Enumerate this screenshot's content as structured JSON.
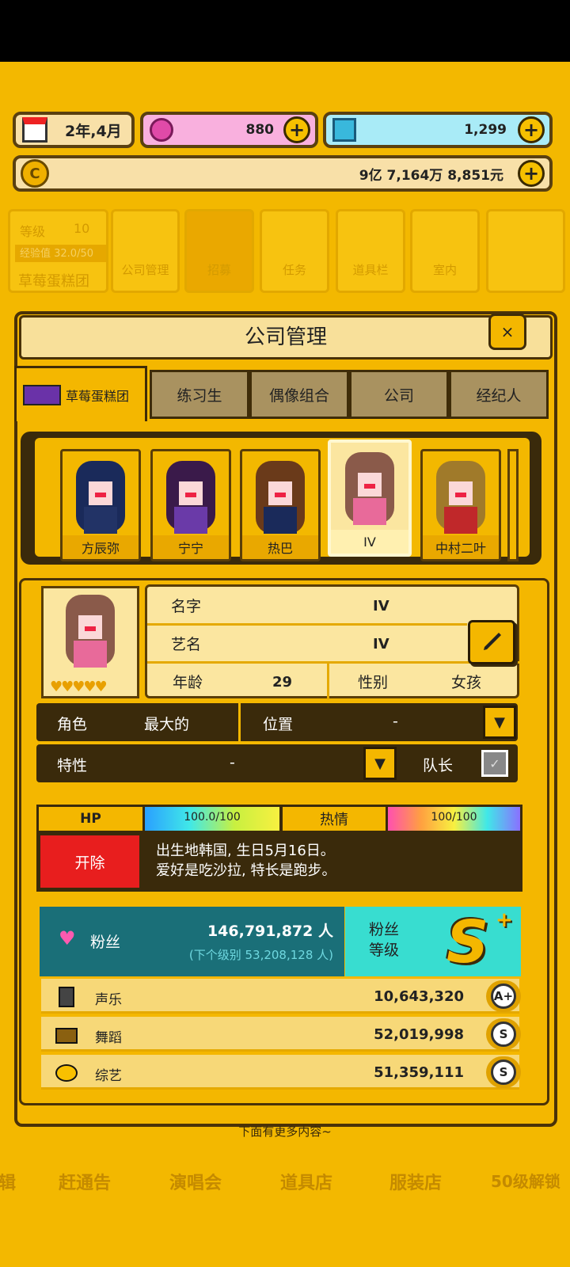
{
  "top": {
    "date": "2年,4月",
    "pink_value": "880",
    "diamond_value": "1,299",
    "money": "9亿 7,164万 8,851元",
    "coin_glyph": "C"
  },
  "bg_menu": {
    "level_label": "等级",
    "level_value": "10",
    "exp_label": "经验值 32.0/50",
    "group_name": "草莓蛋糕团",
    "items": [
      "公司管理",
      "招募",
      "任务",
      "道具栏",
      "室内"
    ]
  },
  "panel": {
    "title": "公司管理",
    "close": "×",
    "tabs": [
      "草莓蛋糕团",
      "练习生",
      "偶像组合",
      "公司",
      "经纪人"
    ],
    "members": [
      "方辰弥",
      "宁宁",
      "热巴",
      "IV",
      "中村二叶"
    ],
    "info": {
      "name_label": "名字",
      "name_value": "IV",
      "stage_label": "艺名",
      "stage_value": "IV",
      "age_label": "年龄",
      "age_value": "29",
      "gender_label": "性别",
      "gender_value": "女孩"
    },
    "role_label": "角色",
    "role_value": "最大的",
    "position_label": "位置",
    "position_value": "-",
    "trait_label": "特性",
    "trait_value": "-",
    "leader_label": "队长",
    "hp_label": "HP",
    "hp_value": "100.0/100",
    "hp_fraction": 1.0,
    "passion_label": "热情",
    "passion_value": "100/100",
    "passion_fraction": 1.0,
    "fire_label": "开除",
    "bio_line1": "出生地韩国, 生日5月16日。",
    "bio_line2": "爱好是吃沙拉, 特长是跑步。",
    "fans_label": "粉丝",
    "fans_value": "146,791,872 人",
    "fans_next": "(下个级别 53,208,128 人)",
    "fan_level_label1": "粉丝",
    "fan_level_label2": "等级",
    "fan_grade": "S",
    "skills": [
      {
        "label": "声乐",
        "value": "10,643,320",
        "grade": "A+"
      },
      {
        "label": "舞蹈",
        "value": "52,019,998",
        "grade": "S"
      },
      {
        "label": "综艺",
        "value": "51,359,111",
        "grade": "S"
      }
    ]
  },
  "footer": {
    "more_hint": "下面有更多内容~",
    "bottom_menu": [
      "辑",
      "赶通告",
      "演唱会",
      "道具店",
      "服装店",
      "50级解锁"
    ]
  },
  "colors": {
    "bg": "#f3b800",
    "dark": "#3a2a0b",
    "teal": "#1a6f78",
    "cyan": "#38ddd0",
    "red": "#e81e1e",
    "pink": "#f9b0de",
    "blue": "#9ee8f5"
  }
}
